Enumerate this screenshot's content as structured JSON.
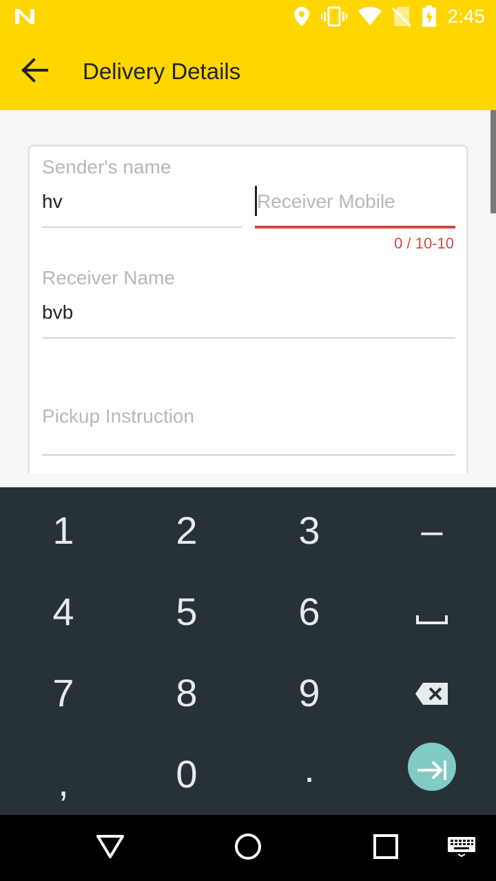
{
  "status_bar": {
    "time": "2:45",
    "icons": [
      "n-logo-icon",
      "location-icon",
      "vibrate-icon",
      "wifi-icon",
      "no-sim-icon",
      "battery-charging-icon"
    ],
    "background": "#ffd600"
  },
  "app_bar": {
    "title": "Delivery Details",
    "back_icon": "arrow-back-icon",
    "background": "#ffd600"
  },
  "form": {
    "sender_name": {
      "label": "Sender's name",
      "value": "hv"
    },
    "receiver_mobile": {
      "placeholder": "Receiver Mobile",
      "value": "",
      "counter": "0 / 10-10",
      "error_color": "#d9463a"
    },
    "receiver_name": {
      "label": "Receiver Name",
      "value": "bvb"
    },
    "pickup_instruction": {
      "placeholder": "Pickup Instruction",
      "value": ""
    }
  },
  "keyboard": {
    "keys": [
      "1",
      "2",
      "3",
      "–",
      "4",
      "5",
      "6",
      "space",
      "7",
      "8",
      "9",
      "backspace",
      ",",
      "0",
      ".",
      "next"
    ],
    "background": "#263238",
    "action_color": "#80cbc4"
  },
  "nav_bar": {
    "buttons": [
      "back-triangle-icon",
      "home-circle-icon",
      "recents-square-icon",
      "keyboard-switch-icon"
    ]
  }
}
